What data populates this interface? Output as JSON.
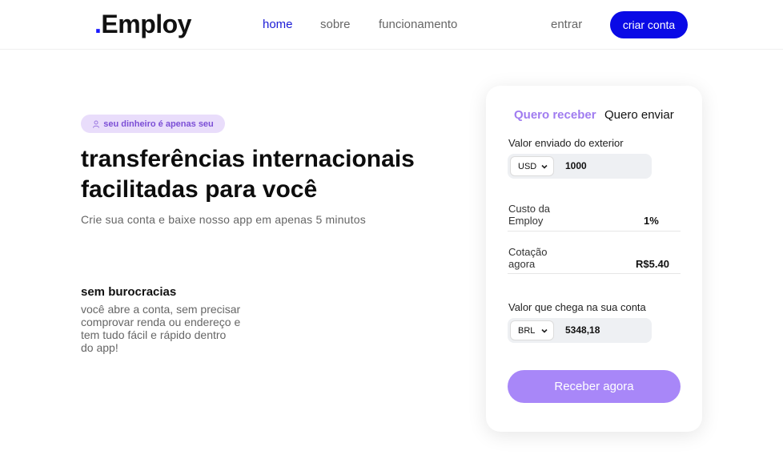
{
  "header": {
    "logo_dot": ".",
    "logo_text": "Employ",
    "nav": {
      "home": "home",
      "sobre": "sobre",
      "funcionamento": "funcionamento"
    },
    "login": "entrar",
    "signup": "criar conta"
  },
  "hero": {
    "badge": "seu dinheiro é apenas seu",
    "title_line1": "transferências internacionais",
    "title_line2": "facilitadas para você",
    "subtitle": "Crie sua conta e baixe nosso app em apenas 5 minutos"
  },
  "feature": {
    "title": "sem burocracias",
    "desc": "você abre a conta, sem precisar comprovar renda ou endereço e tem tudo fácil e rápido dentro do app!"
  },
  "card": {
    "tab_receive": "Quero receber",
    "tab_send": "Quero enviar",
    "sent_label": "Valor enviado do exterior",
    "sent_currency": "USD",
    "sent_amount": "1000",
    "fee_label_1": "Custo da",
    "fee_label_2": "Employ",
    "fee_value": "1%",
    "rate_label_1": "Cotação",
    "rate_label_2": "agora",
    "rate_value": "R$5.40",
    "received_label": "Valor que chega na sua conta",
    "received_currency": "BRL",
    "received_amount": "5348,18",
    "cta": "Receber agora"
  },
  "colors": {
    "brand": "#0a0ae6",
    "accent": "#a887f8",
    "badge_bg": "#e9ddfb"
  },
  "icons": {
    "badge": "user-icon",
    "select": "chevron-down-icon"
  }
}
